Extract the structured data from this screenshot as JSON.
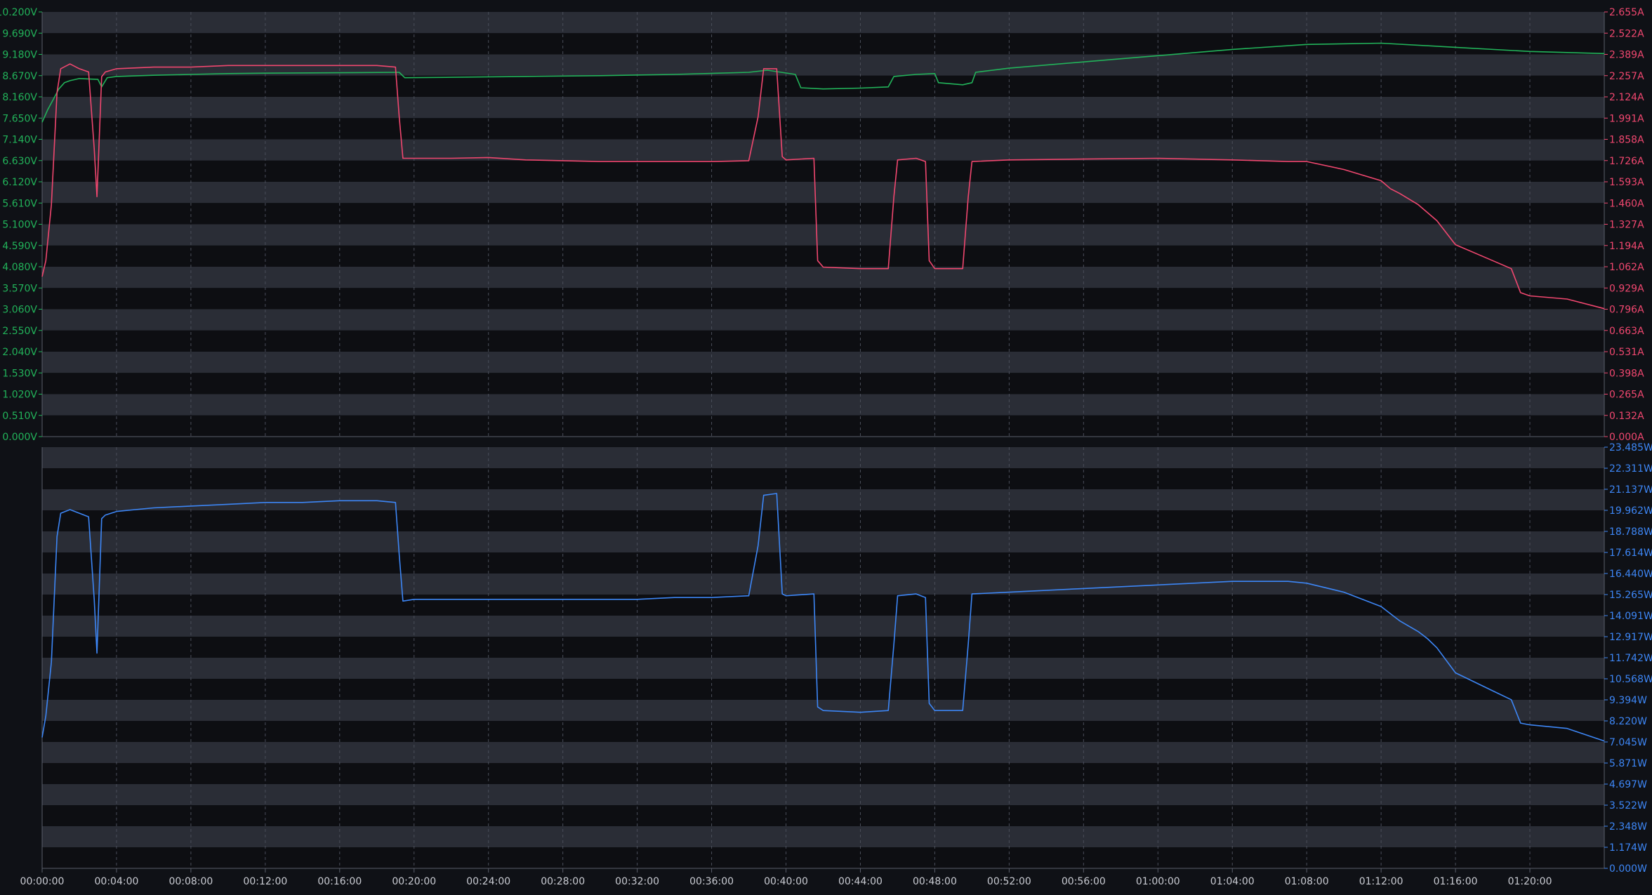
{
  "colors": {
    "background": "#0f1116",
    "band_light": "#2a2d36",
    "band_dark": "#0d0e12",
    "grid": "#4a4e5a",
    "axis": "#5a5e6a",
    "voltage": "#22b35a",
    "current": "#f0476f",
    "power": "#3d86f5",
    "xaxis_text": "#c9cbd2"
  },
  "chart_data": [
    {
      "type": "line",
      "panel": "voltage-current",
      "x_ticks": [
        "00:00:00",
        "00:04:00",
        "00:08:00",
        "00:12:00",
        "00:16:00",
        "00:20:00",
        "00:24:00",
        "00:28:00",
        "00:32:00",
        "00:36:00",
        "00:40:00",
        "00:44:00",
        "00:48:00",
        "00:52:00",
        "00:56:00",
        "01:00:00",
        "01:04:00",
        "01:08:00",
        "01:12:00",
        "01:16:00",
        "01:20:00"
      ],
      "xlim_minutes": [
        0,
        84
      ],
      "y_left": {
        "ticks": [
          "10.200V",
          "9.690V",
          "9.180V",
          "8.670V",
          "8.160V",
          "7.650V",
          "7.140V",
          "6.630V",
          "6.120V",
          "5.610V",
          "5.100V",
          "4.590V",
          "4.080V",
          "3.570V",
          "3.060V",
          "2.550V",
          "2.040V",
          "1.530V",
          "1.020V",
          "0.510V",
          "0.000V"
        ],
        "ylim": [
          0,
          10.2
        ],
        "unit": "V"
      },
      "y_right": {
        "ticks": [
          "2.655A",
          "2.522A",
          "2.389A",
          "2.257A",
          "2.124A",
          "1.991A",
          "1.858A",
          "1.726A",
          "1.593A",
          "1.460A",
          "1.327A",
          "1.194A",
          "1.062A",
          "0.929A",
          "0.796A",
          "0.663A",
          "0.531A",
          "0.398A",
          "0.265A",
          "0.132A",
          "0.000A"
        ],
        "ylim": [
          0,
          2.655
        ],
        "unit": "A"
      },
      "series": [
        {
          "key": "voltage",
          "axis": "left",
          "x": [
            0,
            0.3,
            0.6,
            0.9,
            1.2,
            1.5,
            2,
            3,
            3.2,
            3.5,
            4,
            6,
            8,
            10,
            12,
            16,
            19.2,
            19.5,
            22,
            26,
            30,
            34,
            38,
            39,
            40.5,
            40.8,
            42,
            44,
            45.5,
            45.8,
            47,
            48,
            48.2,
            49.5,
            50,
            50.2,
            52,
            56,
            60,
            64,
            68,
            72,
            76,
            80,
            84
          ],
          "y": [
            7.55,
            7.85,
            8.1,
            8.35,
            8.5,
            8.55,
            8.6,
            8.58,
            8.4,
            8.62,
            8.65,
            8.68,
            8.7,
            8.72,
            8.73,
            8.74,
            8.75,
            8.62,
            8.63,
            8.65,
            8.67,
            8.7,
            8.75,
            8.8,
            8.7,
            8.38,
            8.35,
            8.37,
            8.4,
            8.65,
            8.7,
            8.72,
            8.5,
            8.45,
            8.5,
            8.75,
            8.85,
            9.0,
            9.15,
            9.3,
            9.42,
            9.45,
            9.35,
            9.25,
            9.2
          ]
        },
        {
          "key": "current",
          "axis": "right",
          "x": [
            0,
            0.2,
            0.5,
            0.8,
            1.0,
            1.5,
            2,
            2.5,
            2.8,
            2.95,
            3.05,
            3.2,
            3.4,
            4,
            6,
            8,
            10,
            12,
            14,
            16,
            18,
            19,
            19.2,
            19.4,
            20,
            22,
            24,
            26,
            28,
            30,
            32,
            34,
            36,
            38,
            38.5,
            38.8,
            39.5,
            39.8,
            40,
            41.5,
            41.7,
            42,
            44,
            45.5,
            45.8,
            46,
            47,
            47.5,
            47.7,
            48,
            49.5,
            49.8,
            50,
            52,
            56,
            60,
            64,
            67,
            68,
            70,
            72,
            72.5,
            73,
            74,
            74.5,
            75,
            76,
            78,
            79,
            79.5,
            80,
            82,
            84
          ],
          "y": [
            1.0,
            1.1,
            1.45,
            2.15,
            2.3,
            2.33,
            2.3,
            2.28,
            1.8,
            1.5,
            1.8,
            2.25,
            2.28,
            2.3,
            2.31,
            2.31,
            2.32,
            2.32,
            2.32,
            2.32,
            2.32,
            2.31,
            2.0,
            1.74,
            1.74,
            1.74,
            1.745,
            1.73,
            1.725,
            1.72,
            1.72,
            1.72,
            1.72,
            1.725,
            2.0,
            2.3,
            2.3,
            1.75,
            1.73,
            1.74,
            1.1,
            1.06,
            1.05,
            1.05,
            1.5,
            1.73,
            1.74,
            1.72,
            1.1,
            1.05,
            1.05,
            1.5,
            1.72,
            1.73,
            1.735,
            1.74,
            1.73,
            1.72,
            1.72,
            1.67,
            1.6,
            1.55,
            1.52,
            1.45,
            1.4,
            1.35,
            1.2,
            1.1,
            1.05,
            0.9,
            0.88,
            0.86,
            0.8
          ]
        }
      ]
    },
    {
      "type": "line",
      "panel": "power",
      "x_ticks": [
        "00:00:00",
        "00:04:00",
        "00:08:00",
        "00:12:00",
        "00:16:00",
        "00:20:00",
        "00:24:00",
        "00:28:00",
        "00:32:00",
        "00:36:00",
        "00:40:00",
        "00:44:00",
        "00:48:00",
        "00:52:00",
        "00:56:00",
        "01:00:00",
        "01:04:00",
        "01:08:00",
        "01:12:00",
        "01:16:00",
        "01:20:00"
      ],
      "xlim_minutes": [
        0,
        84
      ],
      "y_right": {
        "ticks": [
          "23.485W",
          "22.311W",
          "21.137W",
          "19.962W",
          "18.788W",
          "17.614W",
          "16.440W",
          "15.265W",
          "14.091W",
          "12.917W",
          "11.742W",
          "10.568W",
          "9.394W",
          "8.220W",
          "7.045W",
          "5.871W",
          "4.697W",
          "3.522W",
          "2.348W",
          "1.174W",
          "0.000W"
        ],
        "ylim": [
          0,
          23.485
        ],
        "unit": "W"
      },
      "series": [
        {
          "key": "power",
          "axis": "right",
          "x": [
            0,
            0.2,
            0.5,
            0.8,
            1.0,
            1.5,
            2,
            2.5,
            2.8,
            2.95,
            3.05,
            3.2,
            3.4,
            4,
            6,
            8,
            10,
            12,
            14,
            16,
            18,
            19,
            19.2,
            19.4,
            20,
            22,
            24,
            26,
            28,
            30,
            32,
            34,
            36,
            38,
            38.5,
            38.8,
            39.5,
            39.8,
            40,
            41.5,
            41.7,
            42,
            44,
            45.5,
            45.8,
            46,
            47,
            47.5,
            47.7,
            48,
            49.5,
            49.8,
            50,
            52,
            56,
            60,
            64,
            67,
            68,
            70,
            72,
            72.5,
            73,
            74,
            74.5,
            75,
            76,
            78,
            79,
            79.5,
            80,
            82,
            84
          ],
          "y": [
            7.3,
            8.5,
            11.5,
            18.5,
            19.8,
            20.0,
            19.8,
            19.6,
            15.0,
            12.0,
            15.0,
            19.5,
            19.7,
            19.9,
            20.1,
            20.2,
            20.3,
            20.4,
            20.4,
            20.5,
            20.5,
            20.4,
            17.5,
            14.9,
            15.0,
            15.0,
            15.0,
            15.0,
            15.0,
            15.0,
            15.0,
            15.1,
            15.1,
            15.2,
            18.0,
            20.8,
            20.9,
            15.3,
            15.2,
            15.3,
            9.0,
            8.8,
            8.7,
            8.8,
            12.5,
            15.2,
            15.3,
            15.1,
            9.2,
            8.8,
            8.8,
            12.5,
            15.3,
            15.4,
            15.6,
            15.8,
            16.0,
            16.0,
            15.9,
            15.4,
            14.6,
            14.2,
            13.8,
            13.2,
            12.8,
            12.3,
            10.9,
            9.9,
            9.4,
            8.1,
            8.0,
            7.8,
            7.1
          ]
        }
      ]
    }
  ]
}
